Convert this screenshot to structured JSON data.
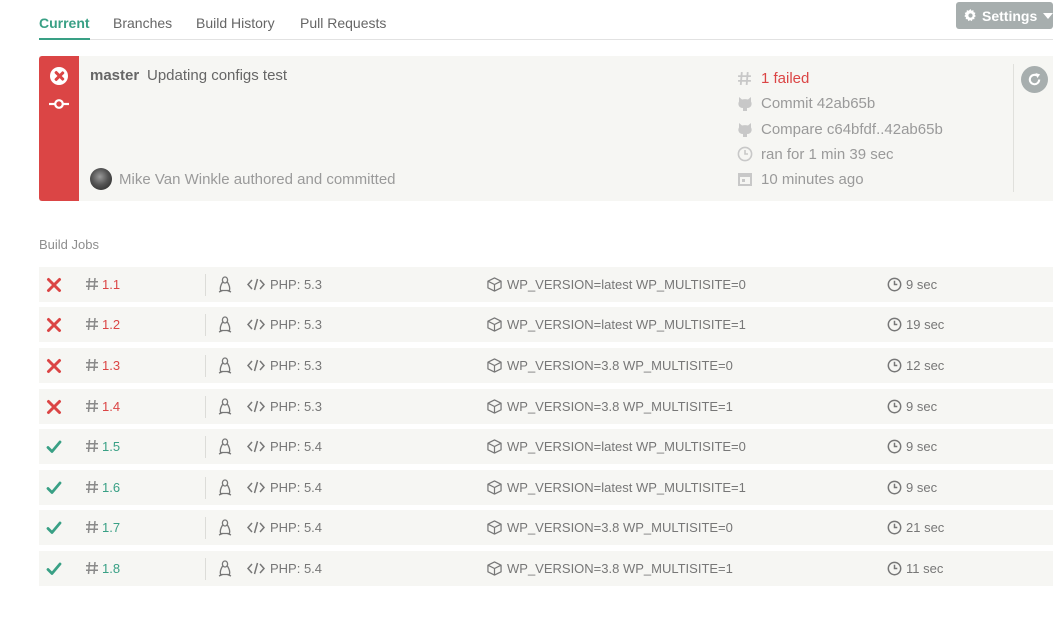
{
  "tabs": [
    {
      "label": "Current",
      "active": true
    },
    {
      "label": "Branches",
      "active": false
    },
    {
      "label": "Build History",
      "active": false
    },
    {
      "label": "Pull Requests",
      "active": false
    }
  ],
  "settings": {
    "label": "Settings"
  },
  "build": {
    "status": "failed",
    "branch": "master",
    "message": "Updating configs test",
    "author": "Mike Van Winkle authored and committed",
    "number_status": "1 failed",
    "commit": "Commit 42ab65b",
    "compare": "Compare c64bfdf..42ab65b",
    "duration": "ran for 1 min 39 sec",
    "finished": "10 minutes ago"
  },
  "jobs_title": "Build Jobs",
  "jobs": [
    {
      "status": "failed",
      "number": "1.1",
      "lang": "PHP: 5.3",
      "env": "WP_VERSION=latest WP_MULTISITE=0",
      "duration": "9 sec"
    },
    {
      "status": "failed",
      "number": "1.2",
      "lang": "PHP: 5.3",
      "env": "WP_VERSION=latest WP_MULTISITE=1",
      "duration": "19 sec"
    },
    {
      "status": "failed",
      "number": "1.3",
      "lang": "PHP: 5.3",
      "env": "WP_VERSION=3.8 WP_MULTISITE=0",
      "duration": "12 sec"
    },
    {
      "status": "failed",
      "number": "1.4",
      "lang": "PHP: 5.3",
      "env": "WP_VERSION=3.8 WP_MULTISITE=1",
      "duration": "9 sec"
    },
    {
      "status": "passed",
      "number": "1.5",
      "lang": "PHP: 5.4",
      "env": "WP_VERSION=latest WP_MULTISITE=0",
      "duration": "9 sec"
    },
    {
      "status": "passed",
      "number": "1.6",
      "lang": "PHP: 5.4",
      "env": "WP_VERSION=latest WP_MULTISITE=1",
      "duration": "9 sec"
    },
    {
      "status": "passed",
      "number": "1.7",
      "lang": "PHP: 5.4",
      "env": "WP_VERSION=3.8 WP_MULTISITE=0",
      "duration": "21 sec"
    },
    {
      "status": "passed",
      "number": "1.8",
      "lang": "PHP: 5.4",
      "env": "WP_VERSION=3.8 WP_MULTISITE=1",
      "duration": "11 sec"
    }
  ],
  "colors": {
    "failed": "#db4545",
    "passed": "#39a085",
    "muted": "#9a9a9a"
  },
  "icons": {
    "status_strip": [
      "error-circle-icon",
      "commit-icon"
    ],
    "meta": [
      "hash-icon",
      "github-icon",
      "github-icon",
      "clock-icon",
      "calendar-icon"
    ],
    "restart": "restart-icon",
    "job_row": [
      "fail-x-icon / check-icon",
      "hash-icon",
      "linux-icon",
      "code-icon",
      "package-icon",
      "clock-icon"
    ]
  }
}
